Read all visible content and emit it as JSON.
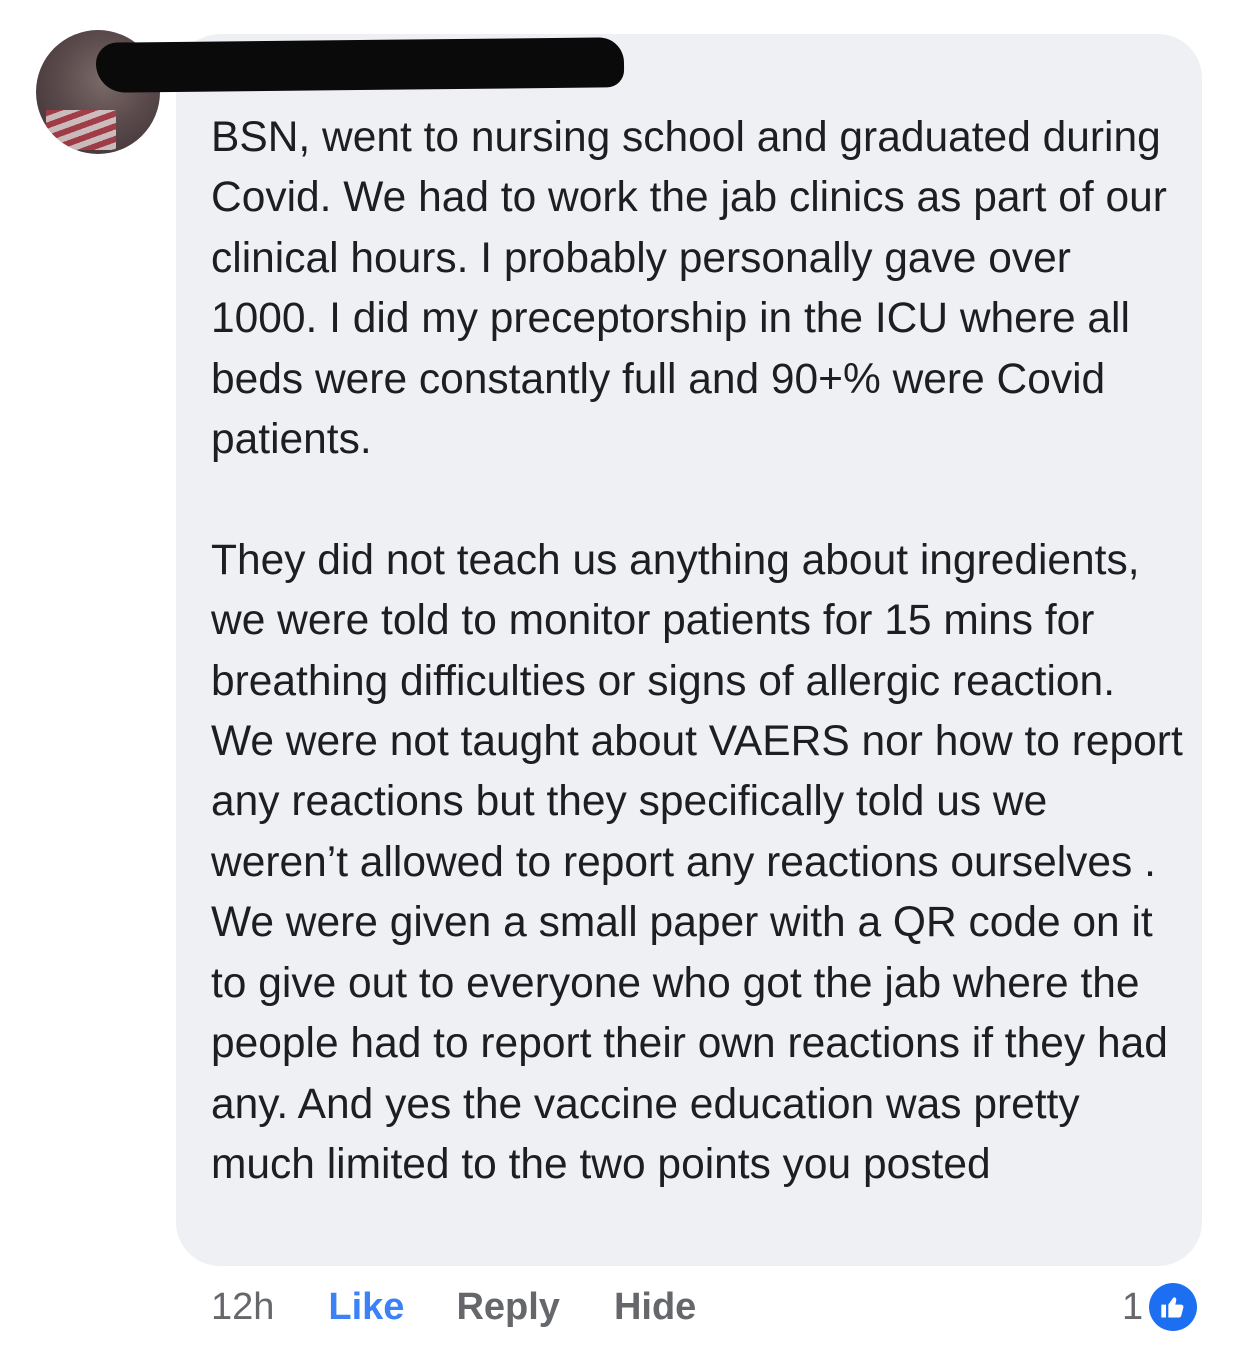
{
  "comment": {
    "author_name": "",
    "body": "BSN, went to nursing school and graduated during Covid. We had to work the jab clinics as part of our clinical hours. I probably personally gave over 1000. I did my preceptorship  in the ICU where all beds were constantly full and 90+% were Covid patients.\n\nThey did not teach us anything about ingredients, we were told to monitor patients for 15 mins for breathing difficulties or signs of allergic reaction. We were not taught about VAERS nor how to report any reactions but they specifically told us we weren’t allowed to report any reactions ourselves . We were given a small paper with a QR code on it to give out to everyone who got the jab where the people had to report their own reactions if they had any. And yes the vaccine education was pretty much limited to the two points you posted",
    "timestamp": "12h",
    "actions": {
      "like_label": "Like",
      "reply_label": "Reply",
      "hide_label": "Hide"
    },
    "reactions": {
      "count": "1",
      "icon": "thumbs-up-icon",
      "color": "#1d6ff2"
    }
  },
  "colors": {
    "bubble_bg": "#eff0f4",
    "text": "#1c1e21",
    "muted": "#65676b",
    "link": "#3b82f6"
  }
}
